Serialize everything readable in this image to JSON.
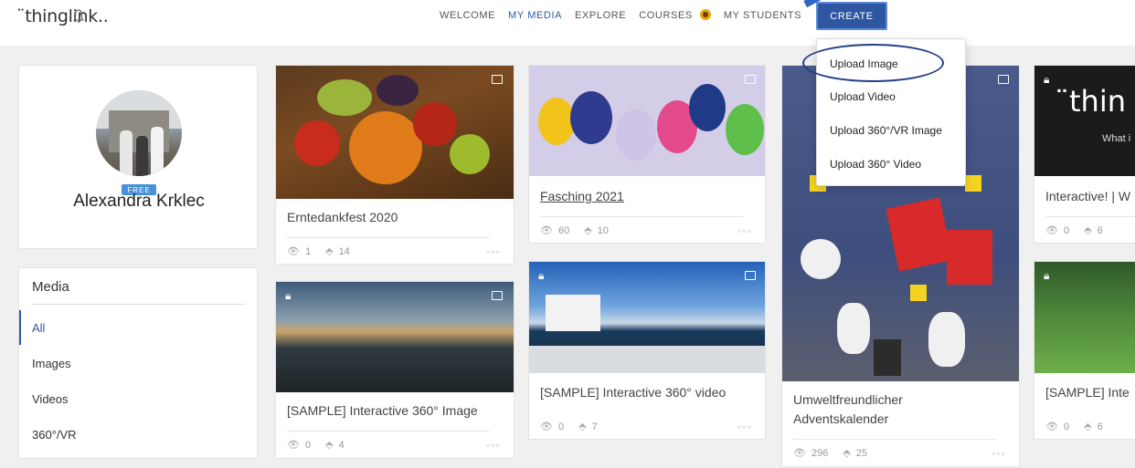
{
  "app": {
    "logo": "¨thinglink.."
  },
  "nav": {
    "items": [
      {
        "label": "WELCOME",
        "active": false
      },
      {
        "label": "MY MEDIA",
        "active": true
      },
      {
        "label": "EXPLORE",
        "active": false
      },
      {
        "label": "COURSES",
        "active": false
      },
      {
        "label": "MY STUDENTS",
        "active": false
      }
    ],
    "create_label": "CREATE"
  },
  "create_menu": {
    "items": [
      "Upload Image",
      "Upload Video",
      "Upload 360°/VR Image",
      "Upload 360° Video"
    ],
    "highlighted": "Upload Image"
  },
  "profile": {
    "name": "Alexandra Krklec",
    "badge": "FREE"
  },
  "media_filter": {
    "title": "Media",
    "items": [
      "All",
      "Images",
      "Videos",
      "360°/VR"
    ],
    "selected": "All"
  },
  "cards": [
    {
      "title": "Erntedankfest 2020",
      "views": "1",
      "tags": "14",
      "type": "image",
      "locked": false
    },
    {
      "title": "[SAMPLE] Interactive 360° Image",
      "views": "0",
      "tags": "4",
      "type": "360",
      "locked": true
    },
    {
      "title": "Fasching 2021",
      "views": "60",
      "tags": "10",
      "type": "image",
      "locked": false
    },
    {
      "title": "[SAMPLE] Interactive 360° video",
      "views": "0",
      "tags": "7",
      "type": "360-video",
      "locked": true
    },
    {
      "title": "Umweltfreundlicher Adventskalender",
      "views": "296",
      "tags": "25",
      "type": "image",
      "locked": false
    },
    {
      "title": "Interactive! | W",
      "views": "0",
      "tags": "6",
      "type": "image",
      "locked": true,
      "thumb_text": "¨thin",
      "thumb_sub": "What i"
    },
    {
      "title": "[SAMPLE] Inte",
      "views": "0",
      "tags": "6",
      "type": "image",
      "locked": true
    }
  ],
  "more_label": "◦◦◦"
}
